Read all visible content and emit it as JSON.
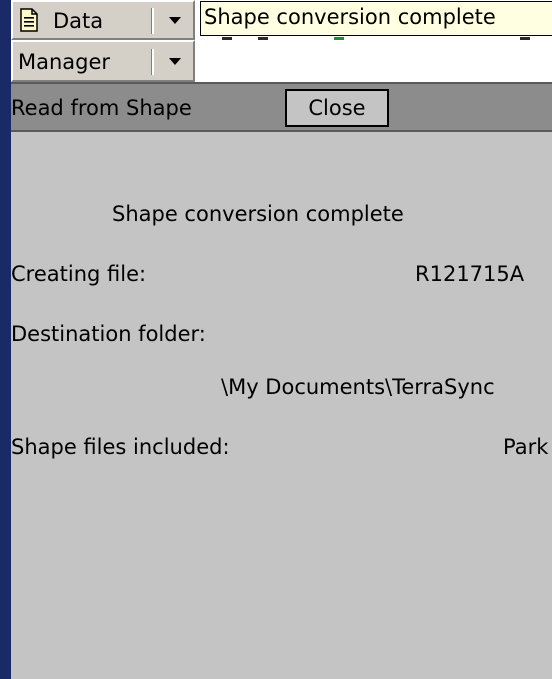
{
  "toolbar": {
    "data_label": "Data",
    "tooltip": "Shape conversion complete",
    "manager_label": "Manager"
  },
  "header": {
    "title": "Read from Shape",
    "close_label": "Close"
  },
  "content": {
    "status": "Shape conversion complete",
    "creating_file_label": "Creating file:",
    "creating_file_value": "R121715A",
    "destination_label": "Destination folder:",
    "destination_value": "\\My Documents\\TerraSync",
    "shape_files_label": "Shape files included:",
    "shape_files_value": "Park"
  }
}
